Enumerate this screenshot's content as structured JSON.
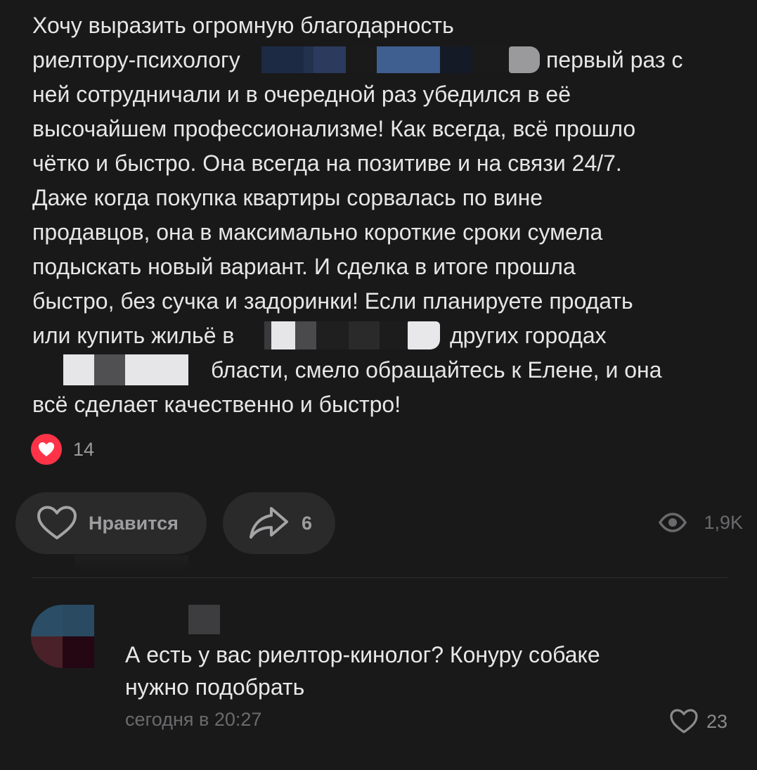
{
  "post": {
    "line1": "Хочу выразить огромную благодарность",
    "line2_a": "риелтору-психологу",
    "line2_b": "первый раз с",
    "line3": "ней сотрудничали и в очередной раз убедился в её",
    "line4": "высочайшем профессионализме! Как всегда, всё прошло",
    "line5": "чётко и быстро. Она всегда на позитиве и на связи 24/7.",
    "line6": "Даже когда покупка квартиры сорвалась по вине",
    "line7": "продавцов, она в максимально короткие сроки сумела",
    "line8": "подыскать новый вариант. И сделка в итоге прошла",
    "line9": "быстро, без сучка и задоринки! Если планируете продать",
    "line10_a": "или купить жильё в",
    "line10_b": "других городах",
    "line11_b": "бласти, смело обращайтесь к Елене, и она",
    "line12": "всё сделает качественно и быстро!"
  },
  "reactions": {
    "icon": "heart-icon",
    "count": "14",
    "badge_color": "#ff3347"
  },
  "actions": {
    "like_label": "Нравится",
    "like_icon": "heart-outline-icon",
    "share_icon": "share-arrow-icon",
    "share_count": "6",
    "views_icon": "eye-icon",
    "views_count": "1,9K"
  },
  "comment": {
    "text_line1": "А есть у вас риелтор-кинолог? Конуру собаке",
    "text_line2": "нужно подобрать",
    "time": "сегодня в 20:27",
    "like_icon": "heart-outline-icon",
    "likes": "23"
  }
}
